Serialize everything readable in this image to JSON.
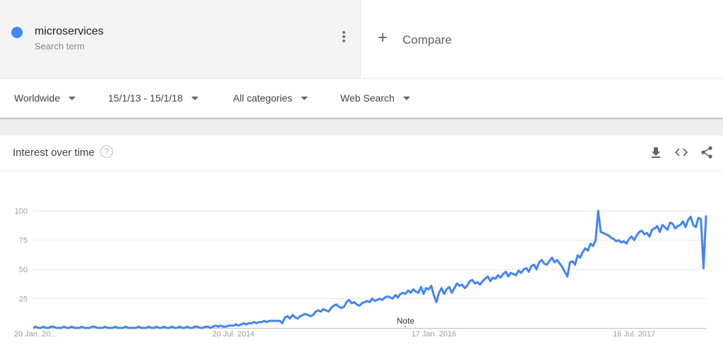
{
  "search_term": {
    "name": "microservices",
    "subtitle": "Search term",
    "color": "#4285f4",
    "more_icon": "more-vert-icon"
  },
  "compare": {
    "icon": "plus-icon",
    "label": "Compare"
  },
  "filters": {
    "region": "Worldwide",
    "date_range": "15/1/13 - 15/1/18",
    "category": "All categories",
    "search_type": "Web Search"
  },
  "card": {
    "title": "Interest over time",
    "help_icon": "help-icon",
    "actions": [
      "download-icon",
      "embed-icon",
      "share-icon"
    ]
  },
  "chart_data": {
    "type": "line",
    "title": "Interest over time",
    "xlabel": "",
    "ylabel": "",
    "ylim": [
      0,
      100
    ],
    "yticks": [
      25,
      50,
      75,
      100
    ],
    "xtick_labels": [
      "20 Jan. 20...",
      "20 Jul. 2014",
      "17 Jan. 2016",
      "16 Jul. 2017"
    ],
    "xtick_index": [
      0,
      78,
      156,
      234
    ],
    "grid": true,
    "annotation": {
      "label": "Note",
      "index": 145
    },
    "series": [
      {
        "name": "microservices",
        "color": "#4285f4",
        "values": [
          0,
          1,
          0,
          0,
          1,
          0,
          0,
          1,
          1,
          0,
          0,
          0,
          1,
          0,
          0,
          1,
          0,
          0,
          0,
          1,
          0,
          0,
          0,
          1,
          1,
          0,
          0,
          0,
          1,
          0,
          0,
          0,
          1,
          0,
          0,
          0,
          1,
          0,
          0,
          0,
          0,
          1,
          0,
          0,
          0,
          1,
          0,
          0,
          1,
          0,
          0,
          1,
          0,
          0,
          1,
          0,
          0,
          1,
          0,
          0,
          1,
          0,
          0,
          1,
          1,
          0,
          0,
          1,
          1,
          0,
          1,
          2,
          1,
          2,
          1,
          1,
          2,
          2,
          2,
          3,
          2,
          3,
          4,
          3,
          4,
          4,
          5,
          4,
          5,
          5,
          6,
          5,
          6,
          6,
          6,
          6,
          6,
          4,
          9,
          10,
          8,
          11,
          9,
          8,
          10,
          11,
          12,
          11,
          10,
          11,
          14,
          15,
          14,
          16,
          15,
          14,
          17,
          19,
          20,
          18,
          17,
          18,
          22,
          24,
          21,
          22,
          20,
          19,
          21,
          22,
          23,
          22,
          25,
          23,
          24,
          25,
          24,
          26,
          27,
          26,
          25,
          28,
          26,
          29,
          30,
          29,
          32,
          30,
          33,
          31,
          30,
          35,
          29,
          34,
          33,
          36,
          28,
          22,
          30,
          34,
          29,
          33,
          35,
          30,
          34,
          38,
          36,
          37,
          34,
          36,
          40,
          41,
          38,
          39,
          37,
          40,
          42,
          44,
          40,
          43,
          42,
          45,
          43,
          46,
          48,
          44,
          47,
          46,
          45,
          49,
          47,
          50,
          51,
          48,
          53,
          54,
          50,
          56,
          58,
          55,
          54,
          57,
          60,
          56,
          58,
          55,
          52,
          48,
          44,
          56,
          57,
          54,
          62,
          60,
          65,
          68,
          66,
          72,
          70,
          75,
          100,
          82,
          81,
          80,
          79,
          77,
          76,
          74,
          75,
          73,
          74,
          72,
          76,
          78,
          75,
          79,
          82,
          83,
          80,
          81,
          78,
          84,
          85,
          87,
          82,
          88,
          86,
          84,
          90,
          89,
          85,
          87,
          88,
          91,
          86,
          92,
          95,
          88,
          86,
          94,
          93,
          51,
          96
        ]
      }
    ]
  }
}
